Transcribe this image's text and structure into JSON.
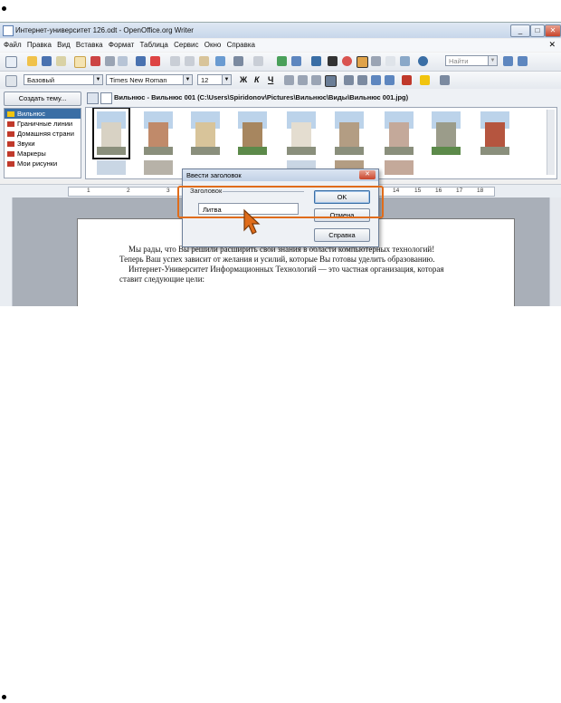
{
  "window": {
    "title": "Интернет-университет 126.odt - OpenOffice.org Writer",
    "controls": [
      "_",
      "□",
      "✕"
    ]
  },
  "menu": [
    "Файл",
    "Правка",
    "Вид",
    "Вставка",
    "Формат",
    "Таблица",
    "Сервис",
    "Окно",
    "Справка"
  ],
  "menu_close": "✕",
  "toolbar": {
    "find_placeholder": "Найти"
  },
  "formatting": {
    "style": "Базовый",
    "font": "Times New Roman",
    "size": "12",
    "bold": "Ж",
    "italic": "К",
    "underline": "Ч"
  },
  "gallery": {
    "create_theme_button": "Создать тему...",
    "path": "Вильнюс - Вильнюс 001 (C:\\Users\\Spiridonov\\Pictures\\Вильнюс\\Виды\\Вильнюс 001.jpg)",
    "themes": [
      {
        "label": "Вильнюс",
        "selected": true
      },
      {
        "label": "Граничные линии",
        "selected": false
      },
      {
        "label": "Домашняя страни",
        "selected": false
      },
      {
        "label": "Звуки",
        "selected": false
      },
      {
        "label": "Маркеры",
        "selected": false
      },
      {
        "label": "Мои рисунки",
        "selected": false
      }
    ]
  },
  "ruler_ticks": [
    "1",
    "2",
    "3",
    "14",
    "15",
    "16",
    "17",
    "18"
  ],
  "document": {
    "line1": "Мы рады, что Вы решили расширить свои знания в области компьютерных технологий!",
    "line2": "Теперь Ваш успех зависит от желания и усилий, которые Вы готовы уделить образованию.",
    "line3": "Интернет-Университет Информационных Технологий — это частная организация, которая",
    "line4": "ставит следующие цели:"
  },
  "dialog": {
    "title": "Ввести заголовок",
    "close": "✕",
    "group_label": "Заголовок",
    "input_value": "Литва",
    "ok_button": "OK",
    "cancel_button": "Отмена",
    "help_button": "Справка"
  },
  "colors": {
    "highlight": "#e06c1a",
    "selection": "#3a6ea5"
  }
}
